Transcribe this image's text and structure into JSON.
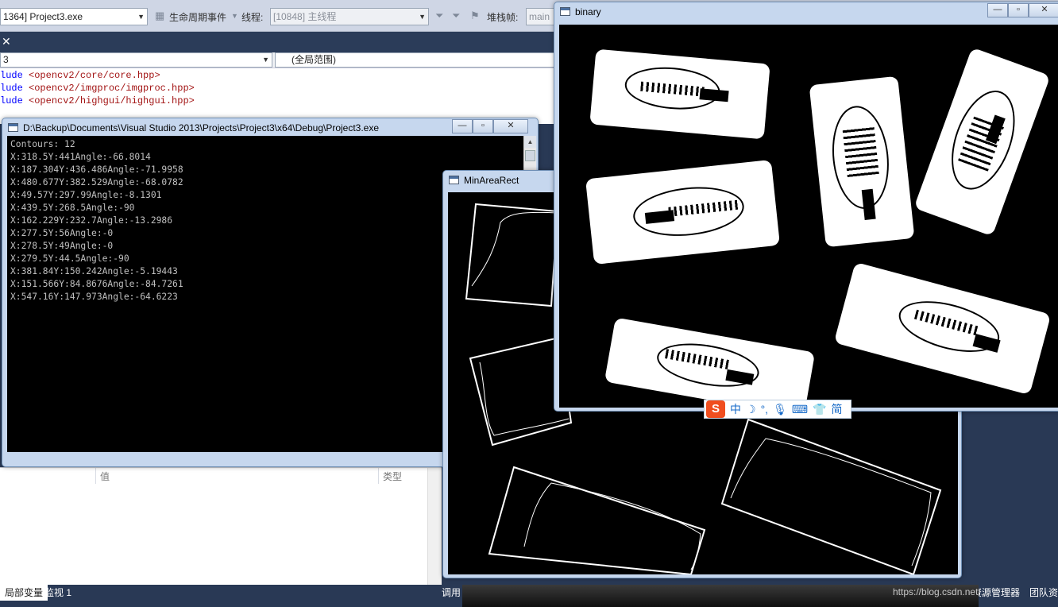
{
  "vs": {
    "process_combo": "1364] Project3.exe",
    "lifecycle_label": "生命周期事件",
    "thread_label": "线程:",
    "thread_combo": "[10848] 主线程",
    "stackframe_label": "堆栈帧:",
    "stackframe_combo": "main",
    "scope_combo": "(全局范围)",
    "nav_left": "3",
    "code": [
      {
        "kw": "lude ",
        "str": "<opencv2/core/core.hpp>"
      },
      {
        "kw": "lude ",
        "str": "<opencv2/imgproc/imgproc.hpp>"
      },
      {
        "kw": "lude ",
        "str": "<opencv2/highgui/highgui.hpp>"
      }
    ],
    "locals_col_value": "值",
    "locals_col_type": "类型",
    "bottom_tab_locals": "局部变量",
    "bottom_tab_watch": "监视 1",
    "bottom_tab_call": "调用",
    "bottom_tab_solution": "资源管理器",
    "bottom_tab_team": "团队资"
  },
  "console": {
    "title": "D:\\Backup\\Documents\\Visual Studio 2013\\Projects\\Project3\\x64\\Debug\\Project3.exe",
    "lines": [
      "Contours: 12",
      "X:318.5Y:441Angle:-66.8014",
      "X:187.304Y:436.486Angle:-71.9958",
      "X:480.677Y:382.529Angle:-68.0782",
      "X:49.57Y:297.99Angle:-8.1301",
      "X:439.5Y:268.5Angle:-90",
      "X:162.229Y:232.7Angle:-13.2986",
      "X:277.5Y:56Angle:-0",
      "X:278.5Y:49Angle:-0",
      "X:279.5Y:44.5Angle:-90",
      "X:381.84Y:150.242Angle:-5.19443",
      "X:151.566Y:84.8676Angle:-84.7261",
      "X:547.16Y:147.973Angle:-64.6223"
    ]
  },
  "minarea": {
    "title": "MinAreaRect"
  },
  "binary": {
    "title": "binary"
  },
  "ime": {
    "lang": "中"
  },
  "watermark": "https://blog.csdn.net/..."
}
